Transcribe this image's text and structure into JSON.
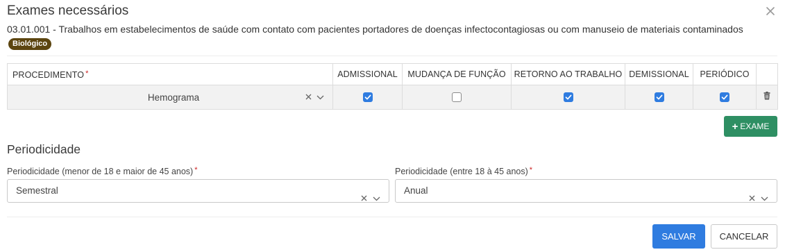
{
  "modal": {
    "title": "Exames necessários",
    "subtitle": "03.01.001 - Trabalhos em estabelecimentos de saúde com contato com pacientes portadores de doenças infectocontagiosas ou com manuseio de materiais contaminados",
    "badge": "Biológico"
  },
  "table": {
    "headers": {
      "procedimento": "PROCEDIMENTO",
      "admissional": "ADMISSIONAL",
      "mudanca": "MUDANÇA DE FUNÇÃO",
      "retorno": "RETORNO AO TRABALHO",
      "demissional": "DEMISSIONAL",
      "periodico": "PERIÓDICO"
    },
    "required_mark": "*",
    "row": {
      "procedimento": "Hemograma",
      "admissional": true,
      "mudanca": false,
      "retorno": true,
      "demissional": true,
      "periodico": true
    }
  },
  "add_exam_button": {
    "plus": "+",
    "label": "EXAME"
  },
  "periodicidade": {
    "title": "Periodicidade",
    "field1": {
      "label": "Periodicidade (menor de 18 e maior de 45 anos)",
      "value": "Semestral"
    },
    "field2": {
      "label": "Periodicidade (entre 18 à 45 anos)",
      "value": "Anual"
    }
  },
  "footer": {
    "save": "SALVAR",
    "cancel": "CANCELAR"
  },
  "icons": {
    "close": "close-icon",
    "clear": "clear-icon",
    "dropdown": "chevron-down-icon",
    "checkbox": "check-icon",
    "delete": "trash-icon",
    "add": "plus-icon"
  },
  "colors": {
    "primary": "#2f7ce0",
    "success": "#2e8f63",
    "badge": "#5c4510",
    "required": "#cc2222"
  }
}
